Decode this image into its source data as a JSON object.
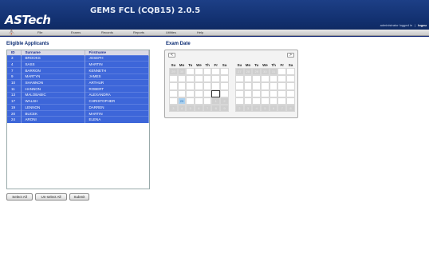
{
  "app": {
    "logo": "ASTech",
    "title": "GEMS FCL (CQB15) 2.0.5"
  },
  "user": {
    "status": "administrator logged in",
    "separator": "|",
    "logout": "logou"
  },
  "menu": {
    "items": [
      "File",
      "Exams",
      "Records",
      "Reports",
      "Utilities",
      "Help"
    ]
  },
  "applicants": {
    "title": "Eligible Applicants",
    "columns": [
      "ID",
      "Surname",
      "Firstname"
    ],
    "rows": [
      [
        "3",
        "BROOKS",
        "JOSEPH"
      ],
      [
        "4",
        "SASS",
        "MARTIN"
      ],
      [
        "7",
        "BARRON",
        "KENNETH"
      ],
      [
        "9",
        "MARTYN",
        "JAMES"
      ],
      [
        "10",
        "SHANNON",
        "ARTHUR"
      ],
      [
        "11",
        "HANNON",
        "ROBERT"
      ],
      [
        "13",
        "MALOBABIC",
        "ALEXANDRA"
      ],
      [
        "17",
        "WALSH",
        "CHRISTOPHER"
      ],
      [
        "19",
        "LENNON",
        "DARREN"
      ],
      [
        "20",
        "BUCEK",
        "MARTIN"
      ],
      [
        "24",
        "ARONI",
        "ELENA"
      ]
    ]
  },
  "buttons": {
    "select_all": "Select All",
    "unselect_all": "Un-select All",
    "submit": "Submit"
  },
  "exam": {
    "title": "Exam Date",
    "prev": "<",
    "next": ">",
    "weekdays": [
      "Su",
      "Mo",
      "Tu",
      "We",
      "Th",
      "Fr",
      "Sa"
    ],
    "month1": {
      "days": [
        "29",
        "30",
        "",
        "",
        "",
        "",
        "",
        "",
        "",
        "",
        "",
        "",
        "",
        "",
        "",
        "",
        "",
        "",
        "",
        "",
        "",
        "",
        "",
        "",
        "",
        "",
        "",
        "",
        "",
        "29",
        "",
        "",
        "",
        "1",
        "2",
        "3",
        "4",
        "5",
        "6",
        "7",
        "8",
        "9"
      ]
    },
    "month2": {
      "days": [
        "27",
        "28",
        "29",
        "30",
        "31",
        "",
        "",
        "",
        "",
        "",
        "",
        "",
        "",
        "",
        "",
        "",
        "",
        "",
        "",
        "",
        "",
        "",
        "",
        "",
        "",
        "",
        "",
        "",
        "",
        "",
        "",
        "",
        "",
        "",
        "",
        "2",
        "3",
        "4",
        "5",
        "6",
        "7",
        "8"
      ]
    }
  }
}
